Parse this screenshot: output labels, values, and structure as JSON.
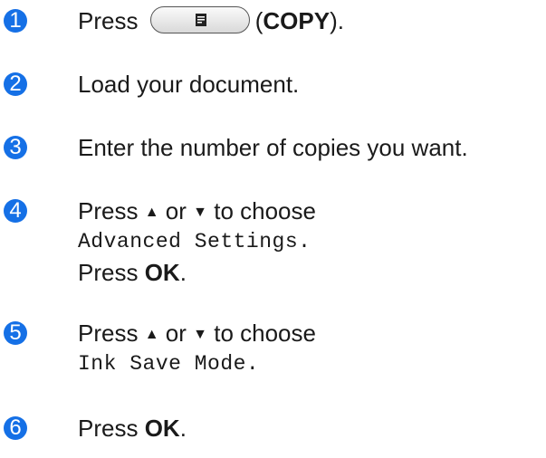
{
  "steps": [
    {
      "num": "1",
      "press": "Press",
      "open": "(",
      "copy": "COPY",
      "close": ")."
    },
    {
      "num": "2",
      "text": "Load your document."
    },
    {
      "num": "3",
      "text": "Enter the number of copies you want."
    },
    {
      "num": "4",
      "press": "Press",
      "up": "▲",
      "or": "or",
      "down": "▼",
      "to_choose": "to choose",
      "setting": "Advanced Settings.",
      "press2": "Press",
      "ok": "OK",
      "dot": "."
    },
    {
      "num": "5",
      "press": "Press",
      "up": "▲",
      "or": "or",
      "down": "▼",
      "to_choose": "to choose",
      "setting": "Ink Save Mode."
    },
    {
      "num": "6",
      "press": "Press",
      "ok": "OK",
      "dot": "."
    }
  ],
  "icons": {
    "copy_button": "copy-document-icon"
  },
  "colors": {
    "badge": "#1570e6"
  }
}
